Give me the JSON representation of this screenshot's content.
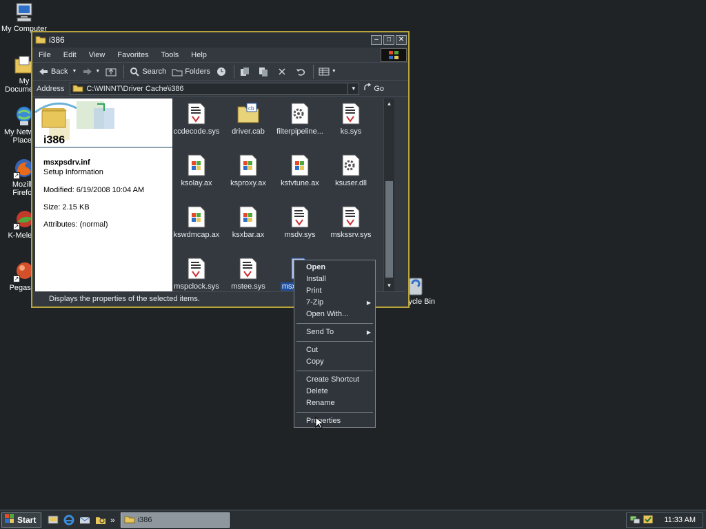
{
  "desktop": {
    "icons": [
      {
        "label": "My Computer",
        "icon": "computer-icon"
      },
      {
        "label": "My Documents",
        "icon": "documents-folder-icon"
      },
      {
        "label": "My Network Places",
        "icon": "network-places-icon"
      },
      {
        "label": "Mozilla Firefox",
        "icon": "firefox-icon"
      },
      {
        "label": "K-Meleon",
        "icon": "kmeleon-icon"
      },
      {
        "label": "Pegasus",
        "icon": "pegasus-icon"
      }
    ],
    "recycle_bin": {
      "label": "Recycle Bin",
      "icon": "recycle-bin-icon"
    }
  },
  "window": {
    "title": "i386",
    "menu": [
      "File",
      "Edit",
      "View",
      "Favorites",
      "Tools",
      "Help"
    ],
    "toolbar": {
      "back": "Back",
      "search": "Search",
      "folders": "Folders"
    },
    "address": {
      "label": "Address",
      "value": "C:\\WINNT\\Driver Cache\\i386",
      "go": "Go"
    },
    "left_pane": {
      "folder_title": "i386",
      "file_name": "msxpsdrv.inf",
      "file_type": "Setup Information",
      "modified": "Modified: 6/19/2008 10:04 AM",
      "size": "Size: 2.15 KB",
      "attributes": "Attributes: (normal)"
    },
    "files": [
      {
        "name": "ccdecode.sys",
        "icon": "sys-file-icon"
      },
      {
        "name": "driver.cab",
        "icon": "cab-folder-icon"
      },
      {
        "name": "filterpipeline...",
        "icon": "dll-gear-icon"
      },
      {
        "name": "ks.sys",
        "icon": "sys-file-icon"
      },
      {
        "name": "ksolay.ax",
        "icon": "ax-file-icon"
      },
      {
        "name": "ksproxy.ax",
        "icon": "ax-file-icon"
      },
      {
        "name": "kstvtune.ax",
        "icon": "ax-file-icon"
      },
      {
        "name": "ksuser.dll",
        "icon": "dll-gear-icon"
      },
      {
        "name": "kswdmcap.ax",
        "icon": "ax-file-icon"
      },
      {
        "name": "ksxbar.ax",
        "icon": "ax-file-icon"
      },
      {
        "name": "msdv.sys",
        "icon": "sys-file-icon"
      },
      {
        "name": "mskssrv.sys",
        "icon": "sys-file-icon"
      },
      {
        "name": "mspclock.sys",
        "icon": "sys-file-icon"
      },
      {
        "name": "mstee.sys",
        "icon": "sys-file-icon"
      },
      {
        "name": "msxp",
        "icon": "inf-file-icon"
      }
    ],
    "status": "Displays the properties of the selected items."
  },
  "context_menu": {
    "groups": [
      [
        {
          "label": "Open",
          "bold": true
        },
        {
          "label": "Install"
        },
        {
          "label": "Print"
        },
        {
          "label": "7-Zip",
          "submenu": true
        },
        {
          "label": "Open With..."
        }
      ],
      [
        {
          "label": "Send To",
          "submenu": true
        }
      ],
      [
        {
          "label": "Cut"
        },
        {
          "label": "Copy"
        }
      ],
      [
        {
          "label": "Create Shortcut"
        },
        {
          "label": "Delete"
        },
        {
          "label": "Rename"
        }
      ],
      [
        {
          "label": "Properties"
        }
      ]
    ]
  },
  "taskbar": {
    "start": "Start",
    "task": "i386",
    "clock": "11:33 AM",
    "chevron": "»"
  },
  "colors": {
    "desktop": "#1f2326",
    "window_border": "#b8a43a",
    "window_bg": "#33393e",
    "accent_blue": "#1f4fa0"
  }
}
